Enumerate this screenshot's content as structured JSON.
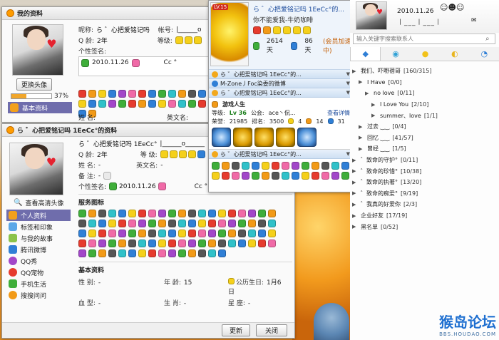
{
  "win_back": {
    "title": "我的资料",
    "change_avatar": "更换头像",
    "progress_pct": 37,
    "progress_label": "37%",
    "nav_item": "基本资料",
    "nickname_label": "昵称:",
    "nickname": "ら ゛心把爱铭记吗",
    "account_label": "帐号:",
    "account_value": "|______o",
    "qage_label": "Q 龄:",
    "qage": "2年",
    "level_label": "等级:",
    "sign_label": "个性签名:",
    "sign_text": "2010.11.26",
    "sign_extra": "Cc  °",
    "name_label": "姓  名:",
    "ename_label": "英文名:"
  },
  "win_front": {
    "title": "ら ゛心把爱铭记吗 1EeCc°的资料",
    "nickname": "ら ゛心把爱铭记吗 1EeCc°",
    "account_value": "|______o______",
    "qage_label": "Q  龄:",
    "qage": "2年",
    "level_label": "等  级:",
    "name_label": "姓  名:",
    "name_value": "-",
    "ename_label": "英文名:",
    "ename_value": "-",
    "remark_label": "备  注:",
    "remark_value": "-",
    "sign_label": "个性签名:",
    "sign_text": "2010.11.26",
    "sign_extra": "Cc  °",
    "view_hd": "查看高清头像",
    "nav": [
      "个人资料",
      "标签和印象",
      "与我的故事",
      "腾讯微博",
      "QQ秀",
      "QQ宠物",
      "手机生活",
      "搜搜问问"
    ],
    "service_title": "服务图标",
    "basic_title": "基本资料",
    "gender_label": "性  别:",
    "gender_value": "-",
    "age_label": "年  龄:",
    "age_value": "15",
    "birthday_label": "公历生日:",
    "birthday_value": "1月6日",
    "blood_label": "血  型:",
    "blood_value": "-",
    "zodiac_label": "生  肖:",
    "zodiac_value": "-",
    "star_label": "星      座:",
    "star_value": "-",
    "update_button": "更新",
    "close_button": "关闭"
  },
  "popup": {
    "level_badge": "LV.15",
    "name": "ら ゛心把爱铭记吗 1EeCc°的...",
    "signature": "你不能爱我-牛奶咖啡",
    "points": "2614天",
    "days": "86天",
    "vip_text": "(会员加速中)",
    "groups": [
      "ら ゛心把爱铭记吗 1EeCc°的...",
      "M-Zone丿Foc染委的微博",
      "ら ゛心把爱铭记吗 1EeCc°的..."
    ],
    "game_title": "游戏人生",
    "game_level_label": "等级:",
    "game_level": "Lv 36",
    "game_guild_label": "公会:",
    "game_guild": "ace丶侃...",
    "game_link": "查看详情",
    "game_exp_label": "荣誉:",
    "game_exp": "21985",
    "game_rank_label": "排名:",
    "game_rank": "3500",
    "game_n1": "4",
    "game_n2": "14",
    "game_n3": "31",
    "bottom_group": "ら ゛心把爱铭记吗 1EeCc°的..."
  },
  "qq": {
    "date": "2010.11.26",
    "nick_line": "丨___丨___丨",
    "search_placeholder": "输入关键字搜索联系人",
    "groups": [
      {
        "name": "我们、吓嘢蓓哥",
        "count": "[160/315]",
        "indent": 0
      },
      {
        "name": "I  Have",
        "count": "[0/0]",
        "indent": 1
      },
      {
        "name": "no  love",
        "count": "[0/11]",
        "indent": 2
      },
      {
        "name": "I Love You",
        "count": "[2/10]",
        "indent": 3
      },
      {
        "name": "summer、love",
        "count": "[1/1]",
        "indent": 3
      },
      {
        "name": "过去  ‿‿",
        "count": "[0/4]",
        "indent": 1
      },
      {
        "name": "回忆  ‿‿",
        "count": "[41/57]",
        "indent": 1
      },
      {
        "name": "曾经  ‿‿",
        "count": "[1/5]",
        "indent": 1
      },
      {
        "name": "゛致命的守护°",
        "count": "[0/11]",
        "indent": 0
      },
      {
        "name": "゛致命的珍惜°",
        "count": "[10/38]",
        "indent": 0
      },
      {
        "name": "゛致命的执著°",
        "count": "[13/20]",
        "indent": 0
      },
      {
        "name": "゛致命的痴爱°",
        "count": "[9/19]",
        "indent": 0
      },
      {
        "name": "゛我真的好爱你",
        "count": "[2/3]",
        "indent": 0
      },
      {
        "name": "企业好友",
        "count": "[17/19]",
        "indent": 0
      },
      {
        "name": "黑名单",
        "count": "[0/52]",
        "indent": 0
      }
    ],
    "watermark": "猴岛论坛",
    "watermark_sub": "BBS.HOUDAO.COM"
  }
}
